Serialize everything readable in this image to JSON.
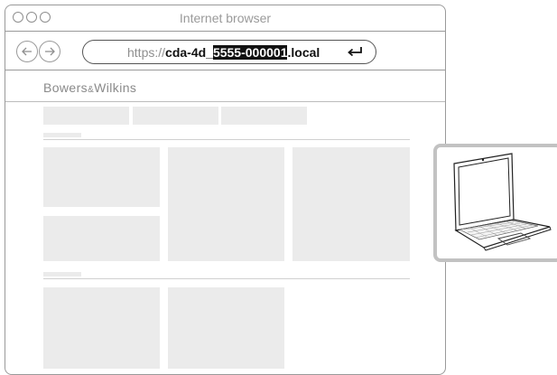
{
  "window": {
    "title": "Internet browser"
  },
  "url": {
    "prefix": "https://",
    "bold_start": "cda-4d_",
    "highlight": "5555-000001",
    "bold_end": ".local"
  },
  "site": {
    "brand_left": "Bowers",
    "brand_amp": "&",
    "brand_right": "Wilkins"
  }
}
